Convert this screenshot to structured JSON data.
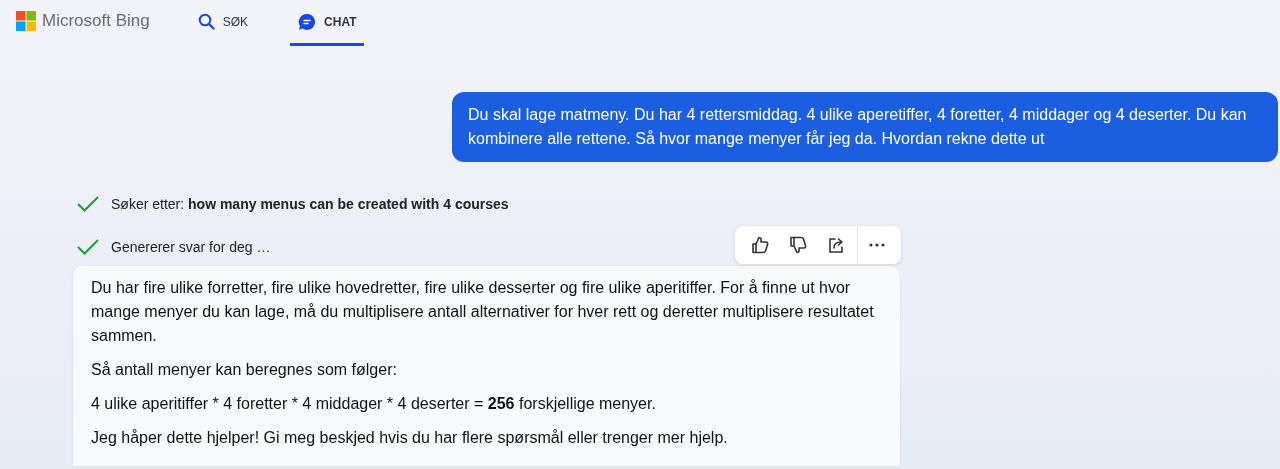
{
  "header": {
    "brand": "Microsoft Bing"
  },
  "tabs": [
    {
      "label": "SØK",
      "kind": "search",
      "selected": false
    },
    {
      "label": "CHAT",
      "kind": "chat",
      "selected": true
    }
  ],
  "user_message": "Du skal lage matmeny. Du har 4 rettersmiddag. 4 ulike aperetiffer, 4 foretter, 4 middager og 4 deserter. Du kan kombinere alle rettene. Så hvor mange menyer får jeg da. Hvordan rekne dette ut",
  "status_lines": [
    {
      "text": "Søker etter: **how many menus can be created with 4 courses**",
      "done": true
    },
    {
      "text": "Genererer svar for deg …",
      "done": true
    }
  ],
  "answer": {
    "paragraphs": [
      "Du har fire ulike forretter, fire ulike hovedretter, fire ulike desserter og fire ulike aperitiffer. For å finne ut hvor mange menyer du kan lage, må du multiplisere antall alternativer for hver rett og deretter multiplisere resultatet sammen.",
      "Så antall menyer kan beregnes som følger:",
      "4 ulike aperitiffer * 4 foretter * 4 middager * 4 deserter = **256** forskjellige menyer.",
      "Jeg håper dette hjelper! Gi meg beskjed hvis du har flere spørsmål eller trenger mer hjelp."
    ]
  },
  "reactions": [
    {
      "kind": "like"
    },
    {
      "kind": "dislike"
    },
    {
      "kind": "share"
    },
    {
      "kind": "more"
    }
  ]
}
